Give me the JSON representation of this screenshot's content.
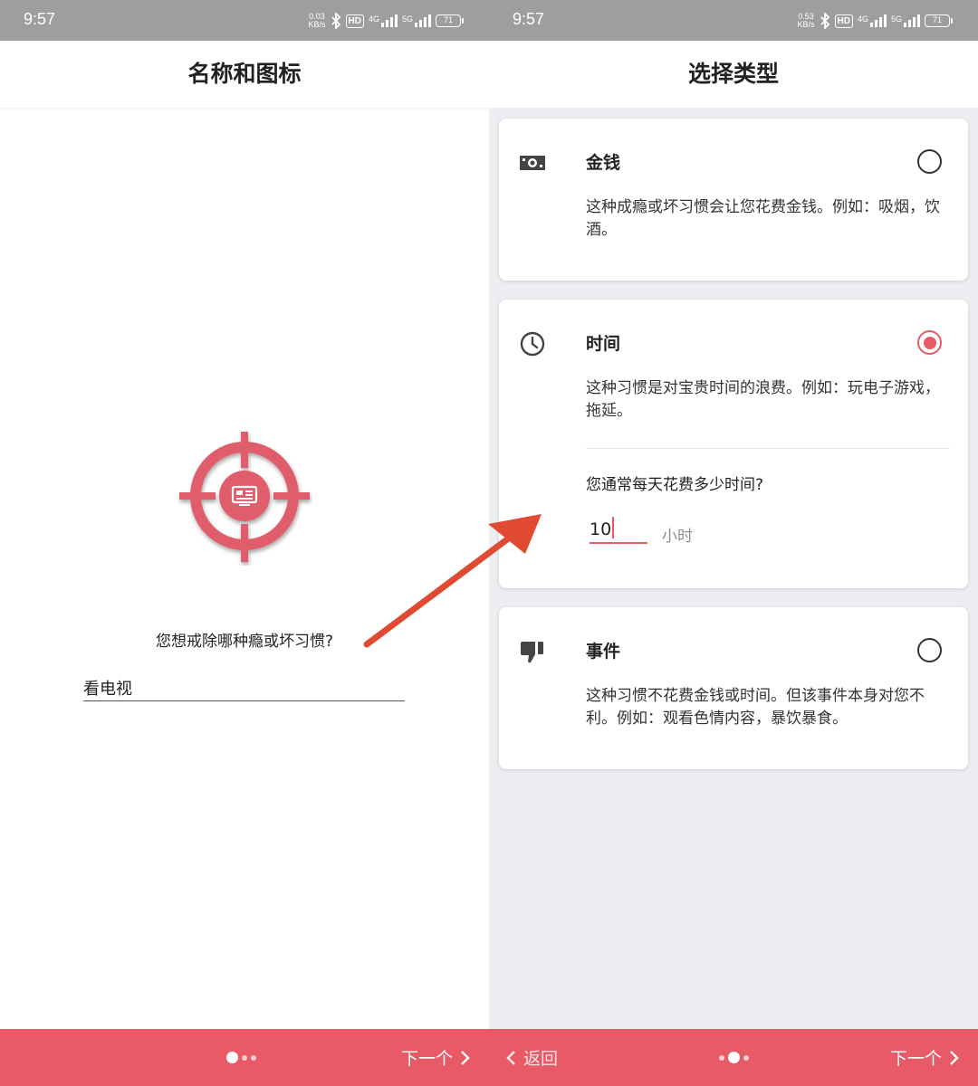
{
  "left": {
    "status": {
      "time": "9:57",
      "speed_value": "0.03",
      "speed_unit": "KB/s",
      "hd": "HD",
      "net1": "4G",
      "net2": "5G",
      "battery": "71"
    },
    "title": "名称和图标",
    "habit_icon": "tv-crosshair-icon",
    "question": "您想戒除哪种瘾或坏习惯?",
    "habit_value": "看电视",
    "next_label": "下一个"
  },
  "right": {
    "status": {
      "time": "9:57",
      "speed_value": "0.53",
      "speed_unit": "KB/s",
      "hd": "HD",
      "net1": "4G",
      "net2": "5G",
      "battery": "71"
    },
    "title": "选择类型",
    "cards": [
      {
        "icon": "money-icon",
        "title": "金钱",
        "desc": "这种成瘾或坏习惯会让您花费金钱。例如：吸烟，饮酒。",
        "selected": false
      },
      {
        "icon": "clock-icon",
        "title": "时间",
        "desc": "这种习惯是对宝贵时间的浪费。例如：玩电子游戏，拖延。",
        "selected": true,
        "question": "您通常每天花费多少时间?",
        "value": "10",
        "unit": "小时"
      },
      {
        "icon": "thumbs-down-icon",
        "title": "事件",
        "desc": "这种习惯不花费金钱或时间。但该事件本身对您不利。例如：观看色情内容，暴饮暴食。",
        "selected": false
      }
    ],
    "back_label": "返回",
    "next_label": "下一个"
  },
  "colors": {
    "accent": "#e85a66",
    "status_bar": "#9e9e9e",
    "right_bg": "#eceef1",
    "arrow": "#e04a33"
  },
  "pager": {
    "left_active": 0,
    "right_active": 1,
    "count": 3
  }
}
